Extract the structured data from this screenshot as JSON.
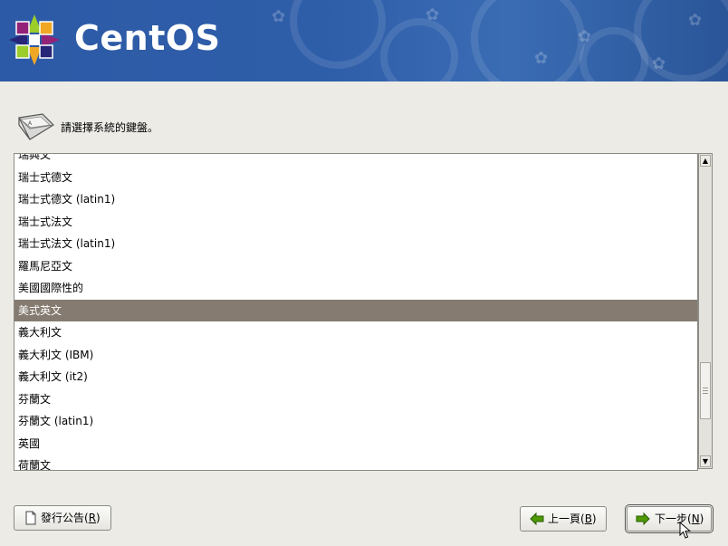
{
  "header": {
    "logo_text": "CentOS"
  },
  "prompt": "請選擇系統的鍵盤。",
  "keyboards": [
    {
      "label": "瑞典文",
      "selected": false
    },
    {
      "label": "瑞士式德文",
      "selected": false
    },
    {
      "label": "瑞士式德文 (latin1)",
      "selected": false
    },
    {
      "label": "瑞士式法文",
      "selected": false
    },
    {
      "label": "瑞士式法文 (latin1)",
      "selected": false
    },
    {
      "label": "羅馬尼亞文",
      "selected": false
    },
    {
      "label": "美國國際性的",
      "selected": false
    },
    {
      "label": "美式英文",
      "selected": true
    },
    {
      "label": "義大利文",
      "selected": false
    },
    {
      "label": "義大利文 (IBM)",
      "selected": false
    },
    {
      "label": "義大利文 (it2)",
      "selected": false
    },
    {
      "label": "芬蘭文",
      "selected": false
    },
    {
      "label": "芬蘭文 (latin1)",
      "selected": false
    },
    {
      "label": "英國",
      "selected": false
    },
    {
      "label": "荷蘭文",
      "selected": false
    }
  ],
  "buttons": {
    "release_notes": {
      "label": "發行公告(",
      "mnemonic": "R",
      "suffix": ")"
    },
    "back": {
      "label": "上一頁(",
      "mnemonic": "B",
      "suffix": ")"
    },
    "next": {
      "label": "下一步(",
      "mnemonic": "N",
      "suffix": ")"
    }
  },
  "colors": {
    "banner": "#2f5ea9",
    "selection": "#857b70",
    "background": "#ecebe6"
  }
}
